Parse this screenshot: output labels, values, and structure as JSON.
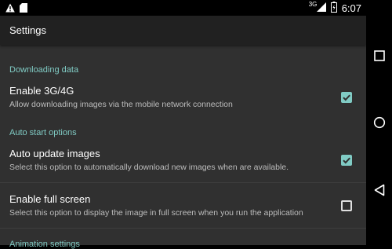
{
  "status_bar": {
    "network_label": "3G",
    "time": "6:07",
    "left_icons": [
      "warning-icon",
      "sd-card-icon"
    ],
    "right_icons": [
      "signal-icon",
      "battery-icon"
    ]
  },
  "toolbar": {
    "title": "Settings"
  },
  "sections": [
    {
      "category": "Downloading data",
      "items": [
        {
          "title": "Enable 3G/4G",
          "summary": "Allow downloading images via the mobile network connection",
          "checked": true
        }
      ]
    },
    {
      "category": "Auto start options",
      "items": [
        {
          "title": "Auto update images",
          "summary": "Select this option to automatically download new images when are available.",
          "checked": true
        },
        {
          "title": "Enable full screen",
          "summary": "Select this option to display the image in full screen when you run the application",
          "checked": false
        }
      ]
    },
    {
      "category": "Animation settings",
      "items": []
    }
  ],
  "nav": [
    "recent-apps-icon",
    "home-icon",
    "back-icon"
  ],
  "colors": {
    "accent": "#80cbc4",
    "background": "#303030",
    "toolbar": "#212121"
  }
}
